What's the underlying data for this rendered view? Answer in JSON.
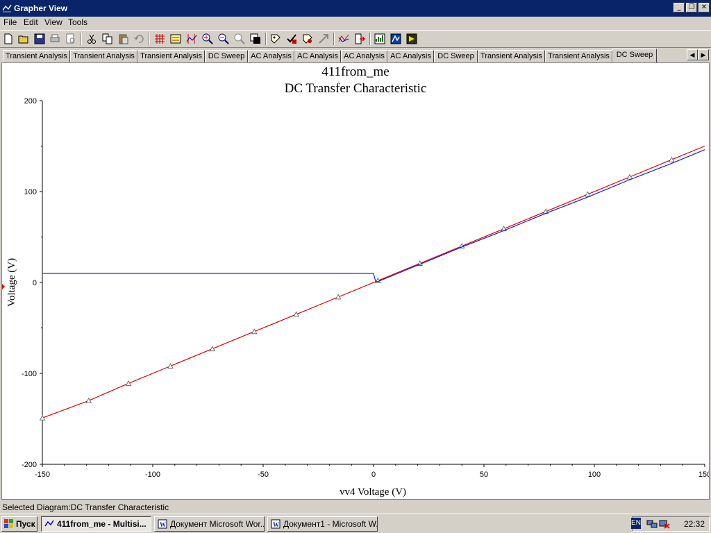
{
  "window": {
    "title": "Grapher View"
  },
  "menu": [
    "File",
    "Edit",
    "View",
    "Tools"
  ],
  "toolbar_icons": [
    "new-icon",
    "open-icon",
    "save-icon",
    "print-icon",
    "print-preview-icon",
    "cut-icon",
    "copy-icon",
    "paste-icon",
    "undo-icon",
    "grid-icon",
    "legend-icon",
    "cursor-icon",
    "zoom-in-icon",
    "zoom-out-icon",
    "zoom-full-icon",
    "reverse-colors-icon",
    "properties-icon",
    "overlay-icon",
    "export-icon",
    "transform-icon",
    "add-trace-icon",
    "analysis-icon",
    "chart-icon",
    "excel-icon"
  ],
  "tabs": [
    "Transient Analysis",
    "Transient Analysis",
    "Transient Analysis",
    "DC Sweep",
    "AC Analysis",
    "AC Analysis",
    "AC Analysis",
    "AC Analysis",
    "DC Sweep",
    "Transient Analysis",
    "Transient Analysis",
    "DC Sweep"
  ],
  "active_tab_index": 11,
  "status": "Selected Diagram:DC Transfer Characteristic",
  "taskbar": {
    "start": "Пуск",
    "items": [
      "411from_me - Multisi...",
      "Документ Microsoft Wor...",
      "Документ1 - Microsoft W..."
    ],
    "lang": "EN",
    "clock": "22:32"
  },
  "colors": {
    "series_red": "#e00000",
    "series_blue": "#1a1adc",
    "title_bar": "#0a246a"
  },
  "chart_data": {
    "type": "line",
    "title": "411from_me",
    "subtitle": "DC Transfer Characteristic",
    "xlabel": "vv4 Voltage (V)",
    "ylabel": "Voltage (V)",
    "xlim": [
      -150,
      150
    ],
    "ylim": [
      -200,
      200
    ],
    "xticks": [
      -150,
      -100,
      -50,
      0,
      50,
      100,
      150
    ],
    "yticks": [
      -200,
      -100,
      0,
      100,
      200
    ],
    "grid": false,
    "series": [
      {
        "color": "#e00000",
        "x": [
          -150,
          -129,
          -111,
          -92,
          -73,
          -54,
          -35,
          -16,
          2,
          21,
          40,
          59,
          78,
          97,
          116,
          135,
          150
        ],
        "y": [
          -149,
          -130,
          -111,
          -92,
          -73,
          -54,
          -35,
          -16,
          2,
          21,
          40,
          59,
          78,
          97,
          116,
          135,
          150
        ],
        "markers": [
          -150,
          -129,
          -111,
          -92,
          -73,
          -54,
          -35,
          -16,
          2,
          21,
          40,
          59,
          78,
          97,
          116,
          135
        ]
      },
      {
        "color": "#1a1adc",
        "x": [
          -150,
          -50,
          0,
          0.5,
          1,
          2,
          21,
          40,
          59,
          78,
          97,
          116,
          135,
          150
        ],
        "y": [
          10,
          10,
          10,
          5,
          1,
          1,
          20,
          39,
          57,
          76,
          94,
          113,
          131,
          146
        ]
      }
    ]
  }
}
